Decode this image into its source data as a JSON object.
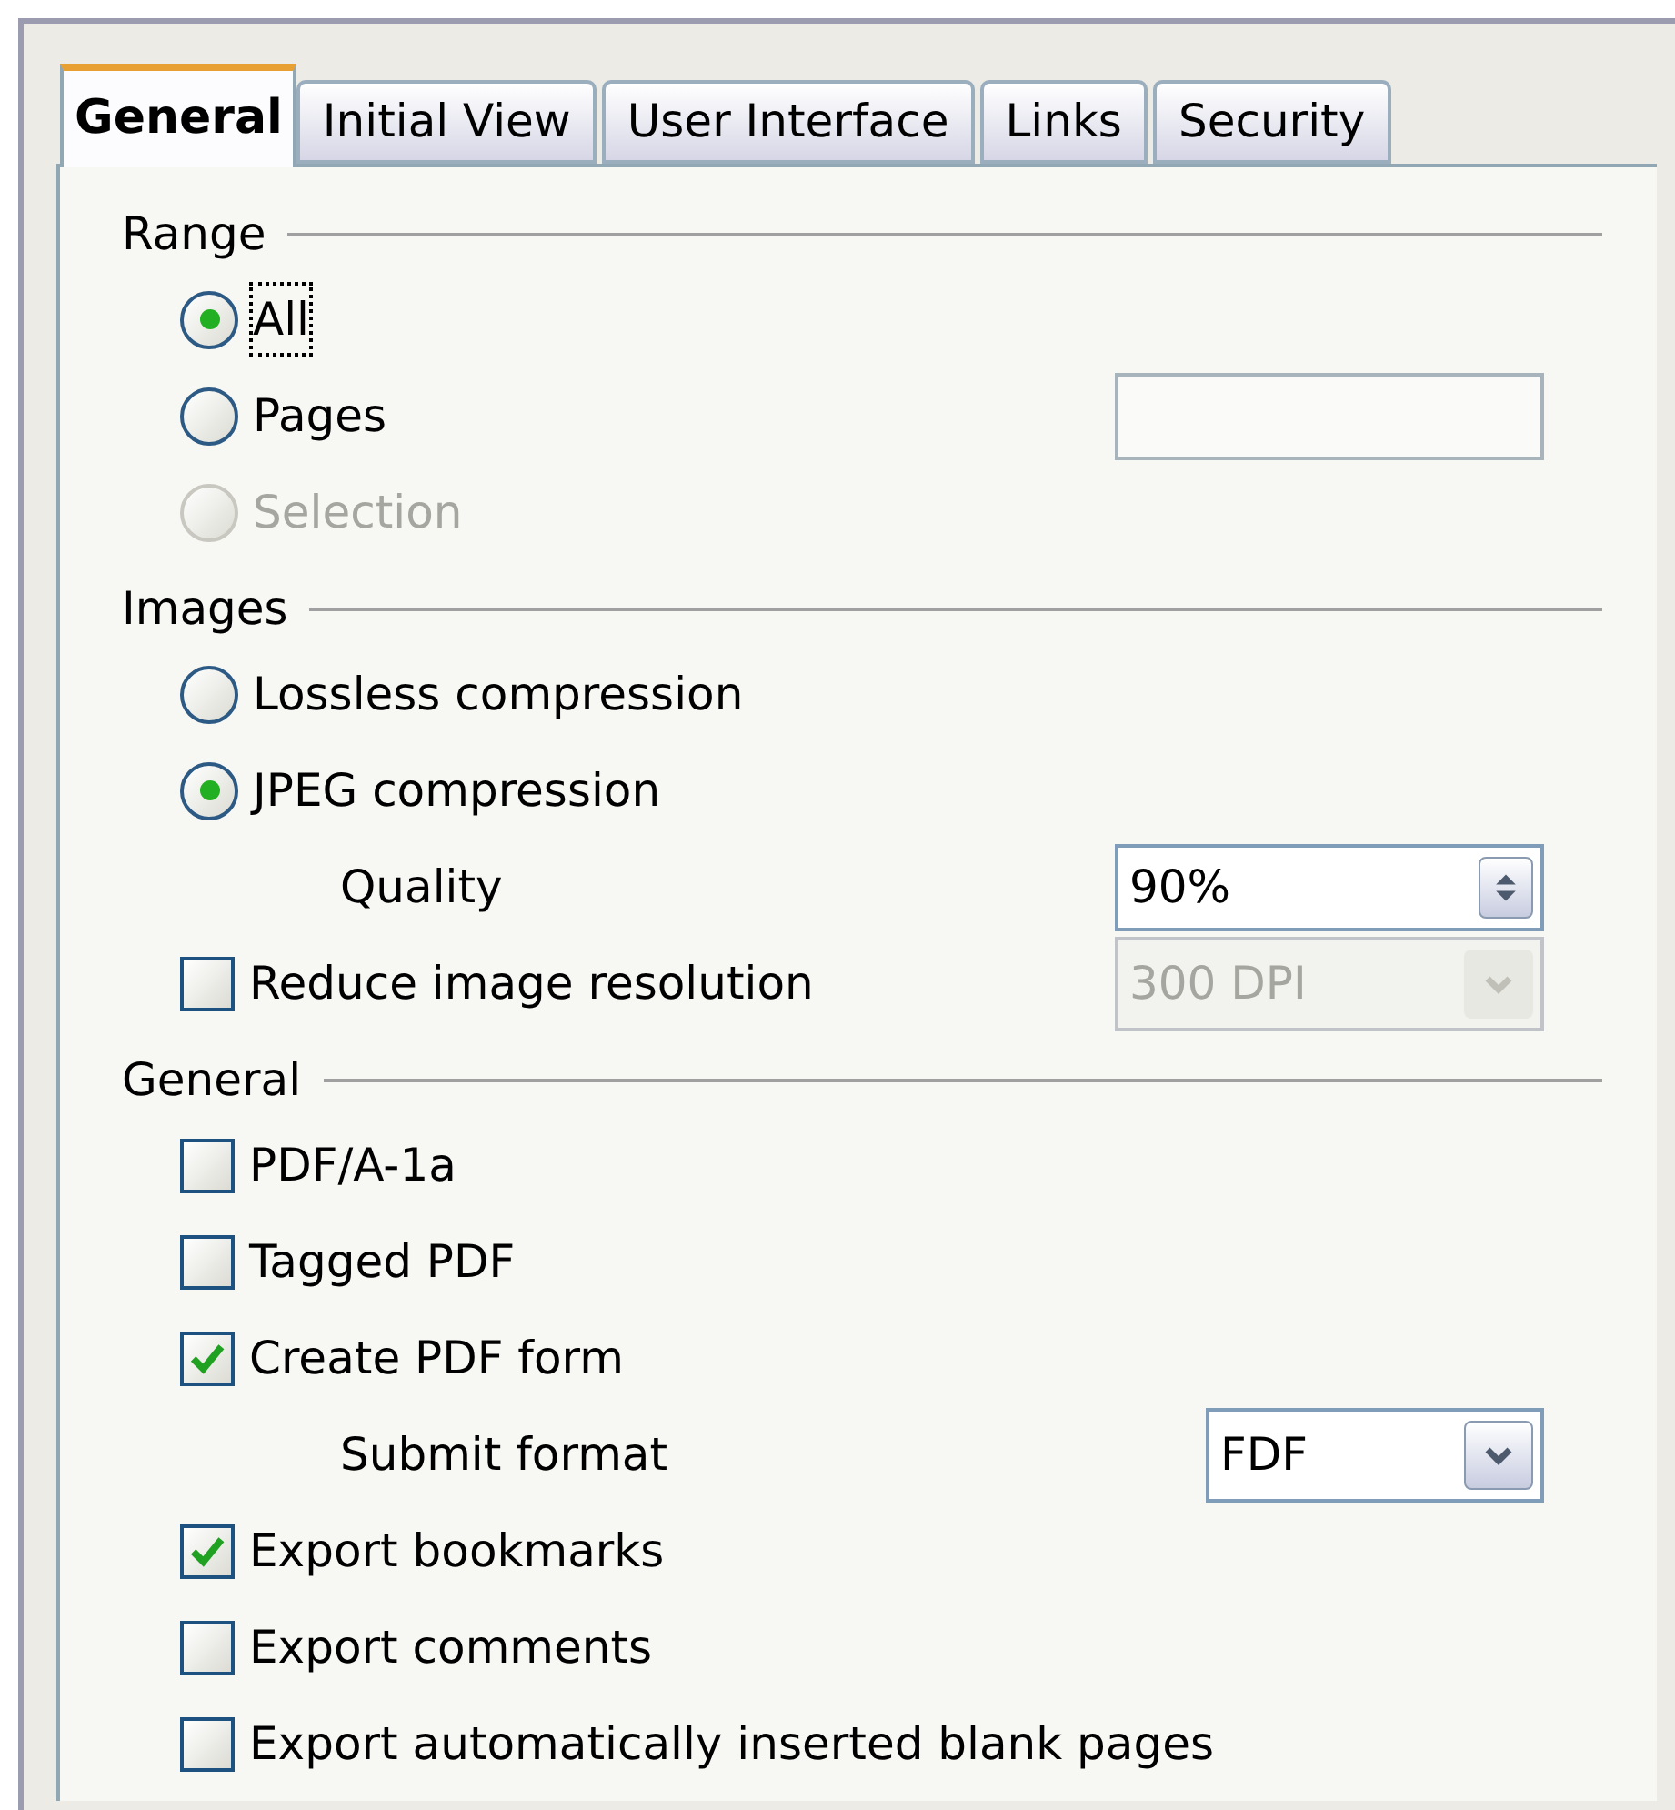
{
  "tabs": [
    {
      "label": "General",
      "selected": true
    },
    {
      "label": "Initial View",
      "selected": false
    },
    {
      "label": "User Interface",
      "selected": false
    },
    {
      "label": "Links",
      "selected": false
    },
    {
      "label": "Security",
      "selected": false
    }
  ],
  "sections": [
    {
      "title": "Range",
      "items": [
        {
          "kind": "radio",
          "label": "All",
          "selected": true,
          "disabled": false,
          "focused": true
        },
        {
          "kind": "radio",
          "label": "Pages",
          "selected": false,
          "disabled": false,
          "focused": false,
          "control": {
            "kind": "text",
            "disabled": false
          }
        },
        {
          "kind": "radio",
          "label": "Selection",
          "selected": false,
          "disabled": true,
          "focused": false
        }
      ]
    },
    {
      "title": "Images",
      "items": [
        {
          "kind": "radio",
          "label": "Lossless compression",
          "selected": false,
          "disabled": false,
          "focused": false
        },
        {
          "kind": "radio",
          "label": "JPEG compression",
          "selected": true,
          "disabled": false,
          "focused": false
        },
        {
          "kind": "label",
          "label": "Quality",
          "control": {
            "kind": "spin",
            "value": "90%",
            "disabled": false
          }
        },
        {
          "kind": "checkbox",
          "label": "Reduce image resolution",
          "checked": false,
          "disabled": false,
          "focused": false,
          "control": {
            "kind": "dropdown",
            "value": "300 DPI",
            "disabled": true
          }
        }
      ]
    },
    {
      "title": "General",
      "items": [
        {
          "kind": "checkbox",
          "label": "PDF/A-1a",
          "checked": false,
          "disabled": false,
          "focused": false
        },
        {
          "kind": "checkbox",
          "label": "Tagged PDF",
          "checked": false,
          "disabled": false,
          "focused": false
        },
        {
          "kind": "checkbox",
          "label": "Create PDF form",
          "checked": true,
          "disabled": false,
          "focused": false
        },
        {
          "kind": "label",
          "label": "Submit format",
          "control": {
            "kind": "dropdown",
            "value": "FDF",
            "disabled": false
          }
        },
        {
          "kind": "checkbox",
          "label": "Export bookmarks",
          "checked": true,
          "disabled": false,
          "focused": false
        },
        {
          "kind": "checkbox",
          "label": "Export comments",
          "checked": false,
          "disabled": false,
          "focused": false
        },
        {
          "kind": "checkbox",
          "label": "Export automatically inserted blank pages",
          "checked": false,
          "disabled": false,
          "focused": false
        }
      ]
    }
  ]
}
